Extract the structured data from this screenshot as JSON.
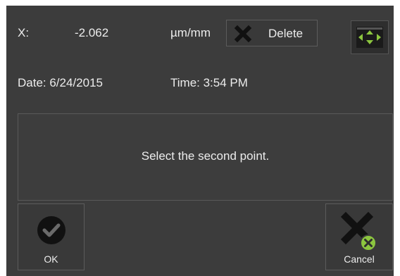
{
  "measurement": {
    "axis_label": "X:",
    "value": "-2.062",
    "unit": "µm/mm"
  },
  "delete_button": {
    "label": "Delete",
    "icon": "x-mark-icon"
  },
  "pan_button": {
    "icon": "pan-arrows-icon"
  },
  "timestamp": {
    "date_text": "Date: 6/24/2015",
    "time_text": "Time: 3:54 PM"
  },
  "message": {
    "text": "Select the second point."
  },
  "ok_button": {
    "label": "OK",
    "icon": "checkmark-circle-icon"
  },
  "cancel_button": {
    "label": "Cancel",
    "icon": "cancel-x-icon"
  },
  "colors": {
    "panel_background": "#3c3c3c",
    "text": "#ececec",
    "icon_green": "#8cc63f",
    "icon_dark": "#111111"
  }
}
